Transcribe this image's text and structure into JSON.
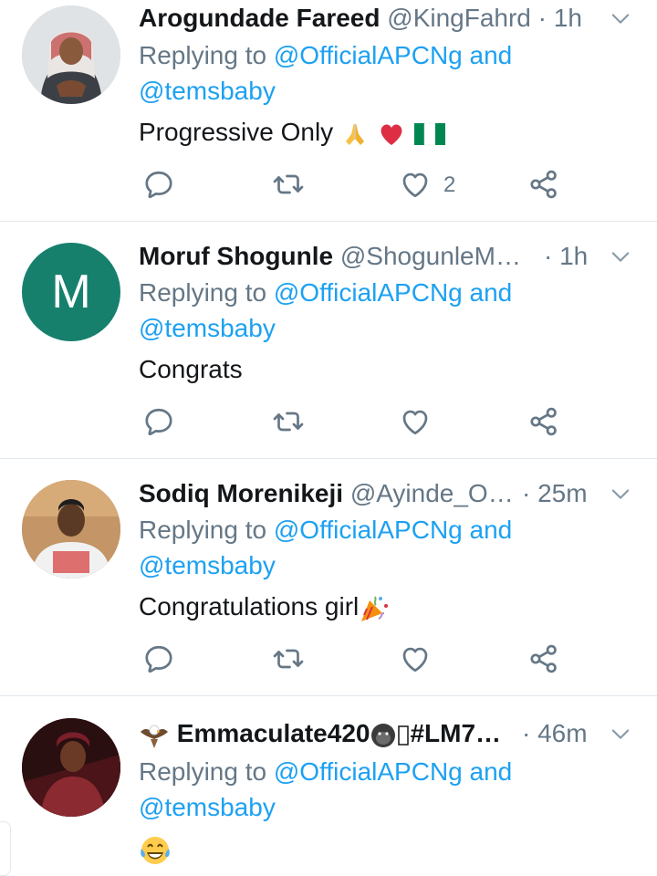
{
  "tweets": [
    {
      "name": "Arogundade Fareed",
      "handle": "@KingFahrd",
      "time": "· 1h",
      "reply_prefix": "Replying to ",
      "mention1": "@OfficialAPCNg",
      "and_text": " and",
      "mention2": "@temsbaby",
      "text": "Progressive Only",
      "like_count": "2"
    },
    {
      "name": "Moruf Shogunle",
      "handle": "@ShogunleM…",
      "time": "· 1h",
      "avatar_letter": "M",
      "reply_prefix": "Replying to ",
      "mention1": "@OfficialAPCNg",
      "and_text": " and",
      "mention2": "@temsbaby",
      "text": "Congrats"
    },
    {
      "name": "Sodiq Morenikeji",
      "handle": "@Ayinde_O…",
      "time": "· 25m",
      "reply_prefix": "Replying to ",
      "mention1": "@OfficialAPCNg",
      "and_text": " and",
      "mention2": "@temsbaby",
      "text": "Congratulations girl"
    },
    {
      "name": "Emmaculate420",
      "name_suffix": "#LM7…",
      "time": "· 46m",
      "reply_prefix": "Replying to ",
      "mention1": "@OfficialAPCNg",
      "and_text": " and",
      "mention2": "@temsbaby"
    }
  ],
  "colors": {
    "link": "#1da1f2",
    "muted": "#657786",
    "like": "#657786",
    "avatar_green": "#17806d"
  },
  "icons": [
    "reply-icon",
    "retweet-icon",
    "like-icon",
    "share-icon",
    "chevron-down-icon"
  ]
}
